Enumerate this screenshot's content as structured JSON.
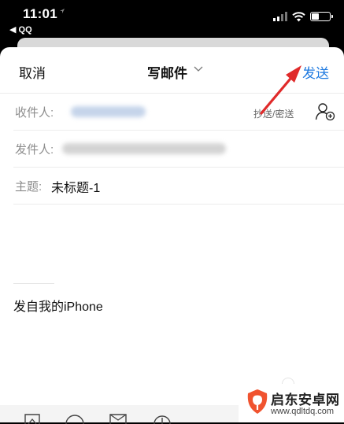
{
  "status_bar": {
    "time": "11:01",
    "back_app": "◀ QQ",
    "battery_level_pct": 45
  },
  "compose": {
    "cancel_label": "取消",
    "title": "写邮件",
    "send_label": "发送",
    "recipient_label": "收件人:",
    "cc_bcc_label": "抄送/密送",
    "sender_label": "发件人:",
    "subject_label": "主题:",
    "subject_value": "未标题-1",
    "signature": "发自我的iPhone"
  },
  "watermark": {
    "title": "启东安卓网",
    "url": "www.qdltdq.com"
  },
  "colors": {
    "accent": "#1f7ae0",
    "annotation_arrow": "#e02a2a",
    "watermark_logo": "#f0532f"
  }
}
